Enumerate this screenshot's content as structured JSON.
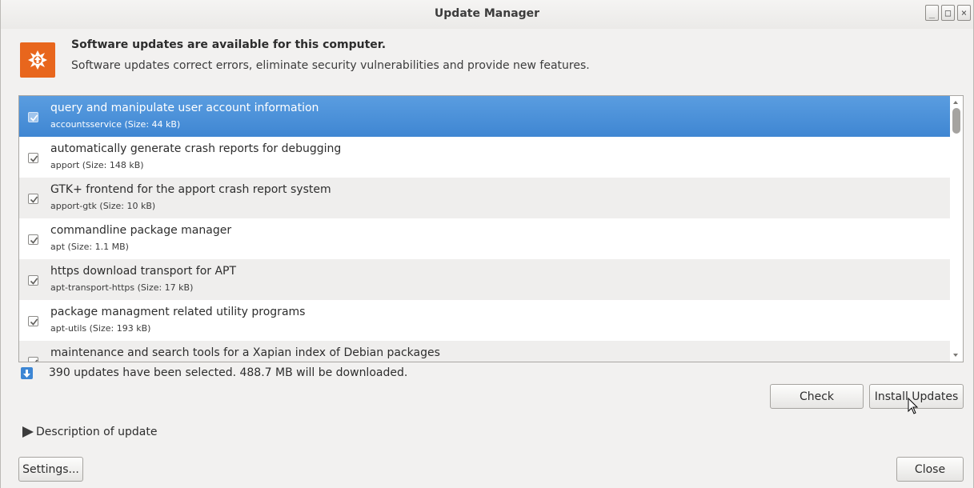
{
  "window": {
    "title": "Update Manager"
  },
  "wm_buttons": {
    "minimize": "_",
    "maximize": "□",
    "close": "×"
  },
  "header": {
    "icon": "update-manager-icon",
    "title": "Software updates are available for this computer.",
    "subtitle": "Software updates correct errors, eliminate security vulnerabilities and provide new features."
  },
  "updates": [
    {
      "description": "query and manipulate user account information",
      "meta": "accountsservice (Size: 44 kB)",
      "checked": true,
      "selected": true
    },
    {
      "description": "automatically generate crash reports for debugging",
      "meta": "apport (Size: 148 kB)",
      "checked": true,
      "selected": false
    },
    {
      "description": "GTK+ frontend for the apport crash report system",
      "meta": "apport-gtk (Size: 10 kB)",
      "checked": true,
      "selected": false
    },
    {
      "description": "commandline package manager",
      "meta": "apt (Size: 1.1 MB)",
      "checked": true,
      "selected": false
    },
    {
      "description": "https download transport for APT",
      "meta": "apt-transport-https (Size: 17 kB)",
      "checked": true,
      "selected": false
    },
    {
      "description": "package managment related utility programs",
      "meta": "apt-utils (Size: 193 kB)",
      "checked": true,
      "selected": false
    },
    {
      "description": "maintenance and search tools for a Xapian index of Debian packages",
      "meta": "",
      "checked": true,
      "selected": false
    }
  ],
  "status": {
    "icon": "download-icon",
    "text": "390 updates have been selected. 488.7 MB will be downloaded."
  },
  "buttons": {
    "check": "Check",
    "install": "Install Updates",
    "settings": "Settings...",
    "close": "Close"
  },
  "expander": {
    "label": "Description of update",
    "expanded": false
  },
  "colors": {
    "selection": "#4a90d9",
    "accent_icon": "#e8661d",
    "background": "#f2f1f0"
  }
}
